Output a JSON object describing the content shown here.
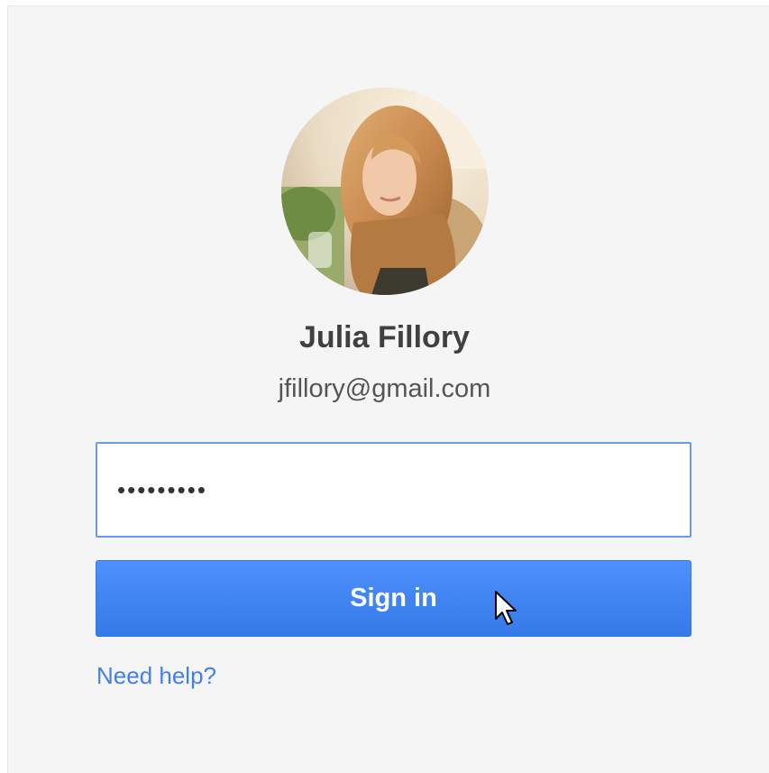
{
  "account": {
    "name": "Julia Fillory",
    "email": "jfillory@gmail.com"
  },
  "password": {
    "value": "•••••••••"
  },
  "signin": {
    "label": "Sign in"
  },
  "help": {
    "label": "Need help?"
  },
  "colors": {
    "button": "#4285f4",
    "link": "#427fed",
    "focus_border": "#6a9be6",
    "background": "#f5f5f5"
  },
  "icons": {
    "pointer": "mouse-pointer-icon"
  }
}
